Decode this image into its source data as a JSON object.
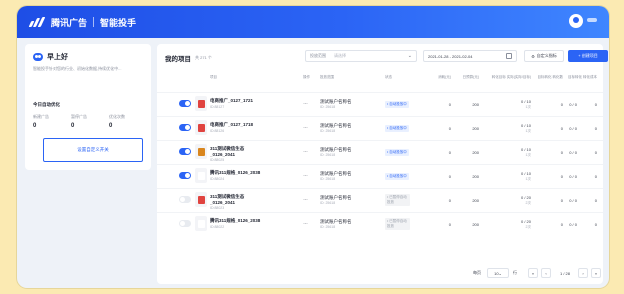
{
  "header": {
    "brand": "腾讯广告",
    "product": "智能投手"
  },
  "left": {
    "greeting": "早上好",
    "description": "智能投手针对您的行业、初始化数据,持续优化中...",
    "today_title": "今日自动优化",
    "stats": [
      {
        "label": "新建广告",
        "value": "0"
      },
      {
        "label": "暂停广告",
        "value": "0"
      },
      {
        "label": "优化次数",
        "value": "0"
      }
    ],
    "custom_button": "设置自定义开关"
  },
  "main": {
    "title": "我的项目",
    "count": "共 271 个",
    "range_key": "投放范围",
    "range_placeholder": "请选择",
    "dates": "2021-01-28 - 2021-02-04",
    "metric_button": "自定义指标",
    "new_button": "+ 创建项目",
    "columns": {
      "project": "项目",
      "op": "操作",
      "account": "投放范围",
      "status": "状态",
      "spend": "消耗(元)",
      "target": "日预算(元)",
      "convert": "转化目标 实际(实际/目标)",
      "conv_count": "目标转化 转化数",
      "cost": "目标转化 转化成本"
    },
    "rows": [
      {
        "on": true,
        "color": "#e0433f",
        "name": "电商推广_0127_1721",
        "id": "ID:88127",
        "account": "测试账户名称名",
        "acct_id": "ID: 25618",
        "status": "• 自动投放中",
        "status_on": true,
        "spend": "0",
        "target": "200",
        "frac": "0 / 10",
        "frac_sub": "1次",
        "conv": "0",
        "cost": "0 / 0",
        "last": "0"
      },
      {
        "on": true,
        "color": "#e0433f",
        "name": "电商推广_0127_1718",
        "id": "ID:88126",
        "account": "测试账户名称名",
        "acct_id": "ID: 25618",
        "status": "• 自动投放中",
        "status_on": true,
        "spend": "0",
        "target": "200",
        "frac": "0 / 10",
        "frac_sub": "1次",
        "conv": "0",
        "cost": "0 / 0",
        "last": "0"
      },
      {
        "on": true,
        "color": "#d9861e",
        "name": "311测试微信生态_0126_2041",
        "id": "ID:88025",
        "account": "测试账户名称名",
        "acct_id": "ID: 25618",
        "status": "• 自动投放中",
        "status_on": true,
        "spend": "0",
        "target": "200",
        "frac": "0 / 10",
        "frac_sub": "1次",
        "conv": "0",
        "cost": "0 / 0",
        "last": "0"
      },
      {
        "on": true,
        "color": "#ffffff",
        "name": "腾讯311规格_0126_2038",
        "id": "ID:88024",
        "account": "测试账户名称名",
        "acct_id": "ID: 25618",
        "status": "• 自动投放中",
        "status_on": true,
        "spend": "0",
        "target": "200",
        "frac": "0 / 10",
        "frac_sub": "1次",
        "conv": "0",
        "cost": "0 / 0",
        "last": "0"
      },
      {
        "on": false,
        "color": "#e0433f",
        "name": "311测试微信生态_0126_2041",
        "id": "ID:88023",
        "account": "测试账户名称名",
        "acct_id": "ID: 25618",
        "status": "• 已暂停自动投放",
        "status_on": false,
        "spend": "0",
        "target": "200",
        "frac": "0 / 20",
        "frac_sub": "2次",
        "conv": "0",
        "cost": "0 / 0",
        "last": "0"
      },
      {
        "on": false,
        "color": "#ffffff",
        "name": "腾讯311规格_0126_2038",
        "id": "ID:88022",
        "account": "测试账户名称名",
        "acct_id": "ID: 25618",
        "status": "• 已暂停自动投放",
        "status_on": false,
        "spend": "0",
        "target": "200",
        "frac": "0 / 20",
        "frac_sub": "2次",
        "conv": "0",
        "cost": "0 / 0",
        "last": "0"
      }
    ],
    "pager": {
      "per_page_label": "每页",
      "per_page": "10",
      "unit": "行",
      "page": "1 / 28"
    }
  }
}
